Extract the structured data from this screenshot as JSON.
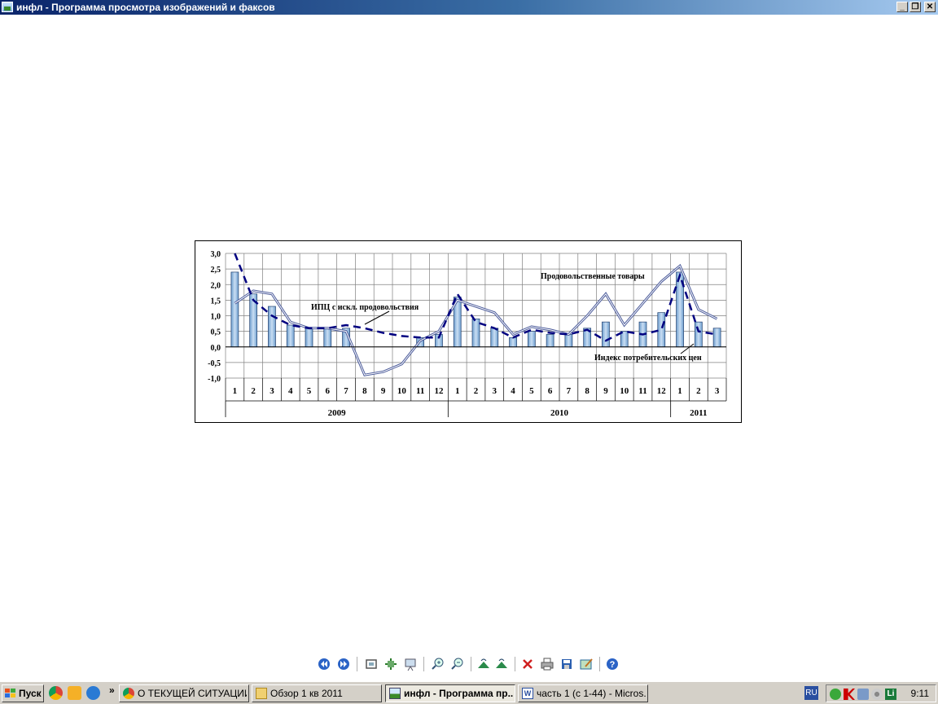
{
  "window": {
    "title": "инфл - Программа просмотра изображений и факсов",
    "controls": [
      "minimize",
      "restore",
      "close"
    ]
  },
  "chart_data": {
    "type": "bar",
    "title": "",
    "ylim": [
      -1.0,
      3.0
    ],
    "y_ticks": [
      "3,0",
      "2,5",
      "2,0",
      "1,5",
      "1,0",
      "0,5",
      "0,0",
      "-0,5",
      "-1,0"
    ],
    "categories": [
      "1",
      "2",
      "3",
      "4",
      "5",
      "6",
      "7",
      "8",
      "9",
      "10",
      "11",
      "12",
      "1",
      "2",
      "3",
      "4",
      "5",
      "6",
      "7",
      "8",
      "9",
      "10",
      "11",
      "12",
      "1",
      "2",
      "3"
    ],
    "year_groups": [
      {
        "label": "2009",
        "count": 12
      },
      {
        "label": "2010",
        "count": 12
      },
      {
        "label": "2011",
        "count": 3
      }
    ],
    "grid": true,
    "series": [
      {
        "name": "",
        "kind": "bar",
        "values": [
          2.4,
          1.7,
          1.3,
          0.7,
          0.6,
          0.6,
          0.6,
          0,
          0,
          0,
          0.3,
          0.4,
          1.6,
          0.9,
          0.6,
          0.3,
          0.5,
          0.4,
          0.4,
          0.6,
          0.8,
          0.5,
          0.8,
          1.1,
          2.4,
          0.8,
          0.6
        ],
        "color": "#9dc3e6"
      },
      {
        "name": "Индекс потребительских цен",
        "kind": "dashed-line",
        "values": [
          3.0,
          1.5,
          1.0,
          0.7,
          0.6,
          0.6,
          0.7,
          0.6,
          0.45,
          0.35,
          0.3,
          0.3,
          1.7,
          0.8,
          0.6,
          0.3,
          0.55,
          0.45,
          0.4,
          0.55,
          0.2,
          0.5,
          0.4,
          0.55,
          2.3,
          0.5,
          0.4
        ],
        "color": "#000080"
      },
      {
        "name": "Продовольственные товары",
        "kind": "double-line",
        "values": [
          1.4,
          1.8,
          1.7,
          0.8,
          0.6,
          0.6,
          0.5,
          -0.9,
          -0.8,
          -0.55,
          0.2,
          0.5,
          1.5,
          1.3,
          1.1,
          0.4,
          0.65,
          0.55,
          0.4,
          1.0,
          1.7,
          0.7,
          1.4,
          2.1,
          2.6,
          1.2,
          0.9
        ],
        "color": "#4a5a9a"
      },
      {
        "name": "ИПЦ с искл. продовольствия",
        "kind": "label-only"
      }
    ],
    "annotations": [
      {
        "text": "Продовольственные товары"
      },
      {
        "text": "ИПЦ с искл. продовольствия"
      },
      {
        "text": "Индекс потребительских цен"
      }
    ]
  },
  "toolbar": {
    "buttons": [
      "previous-image",
      "next-image",
      "best-fit",
      "actual-size",
      "slideshow",
      "zoom-in",
      "zoom-out",
      "rotate-clockwise",
      "rotate-counterclockwise",
      "delete",
      "print",
      "copy-to",
      "open-for-editing",
      "help"
    ]
  },
  "taskbar": {
    "start_label": "Пуск",
    "more_label": "»",
    "tasks": [
      {
        "label": "О ТЕКУЩЕЙ СИТУАЦИИ...",
        "icon": "chrome-icon",
        "active": false
      },
      {
        "label": "Обзор 1 кв 2011",
        "icon": "folder-icon",
        "active": false
      },
      {
        "label": "инфл - Программа пр...",
        "icon": "image-viewer-icon",
        "active": true
      },
      {
        "label": "часть 1 (с 1-44) - Micros...",
        "icon": "word-icon",
        "active": false
      }
    ],
    "language": "RU",
    "clock": "9:11"
  }
}
